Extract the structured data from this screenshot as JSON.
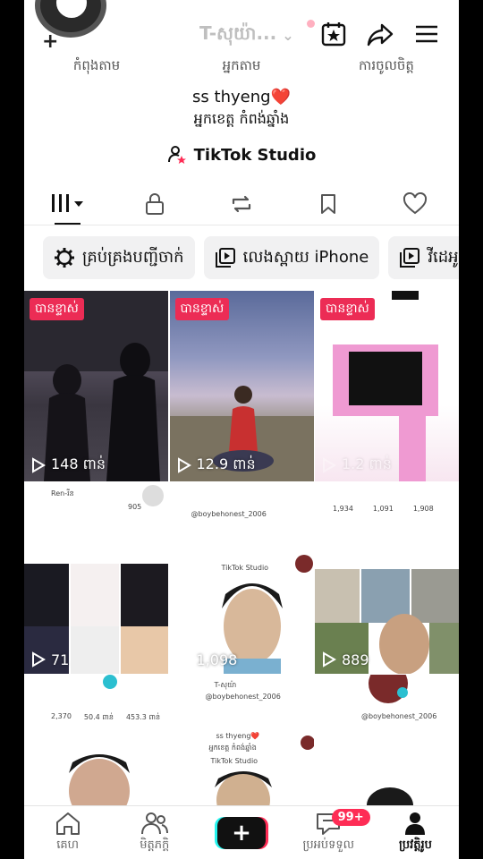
{
  "header": {
    "account_name": "T-សុយ៉ា...",
    "chevron": "⌄",
    "add_plus": "+"
  },
  "stats": [
    "កំពុងតាម",
    "អ្នកតាម",
    "ការចូលចិត្ត"
  ],
  "profile": {
    "name": "ss thyeng❤️",
    "bio": "អ្នកខេត្ត កំពង់ឆ្នាំង",
    "studio_label": "TikTok Studio"
  },
  "chips": [
    {
      "label": "គ្រប់គ្រងបញ្ជីចាក់",
      "icon": "gear-icon"
    },
    {
      "label": "លេងស្ពាយ iPhone",
      "icon": "play-square-icon"
    },
    {
      "label": "វីដេអូរអ",
      "icon": "play-square-icon"
    }
  ],
  "tiles": [
    {
      "badge": "បានខ្ទាស់",
      "views": "148 ពាន់"
    },
    {
      "badge": "បានខ្ទាស់",
      "views": "12.9 ពាន់"
    },
    {
      "badge": "បានខ្ទាស់",
      "views": "1.2 ពាន់"
    },
    {
      "views": "71"
    },
    {
      "views": "1,098"
    },
    {
      "views": "889"
    },
    {},
    {},
    {}
  ],
  "mini": {
    "tile4_user": "Ren-រីន",
    "tile4_stat": "905",
    "tile5_handle": "@boybehonest_2006",
    "tile5_studio": "TikTok Studio",
    "tile6_stats": [
      "1,934",
      "1,091",
      "1,908"
    ],
    "tile8_user": "T-សុយ៉ា",
    "tile8_handle": "@boybehonest_2006",
    "tile8_stats": [
      "2,370",
      "50.4 ពាន់",
      "453.3 ពាន់"
    ],
    "tile8_name": "ss thyeng❤️",
    "tile8_bio": "អ្នកខេត្ត កំពង់ឆ្នាំង",
    "tile8_studio": "TikTok Studio",
    "tile9_handle": "@boybehonest_2006"
  },
  "nav": {
    "home": "គេហ",
    "friends": "មិត្តភក្តិ",
    "inbox": "ប្រអប់ទទួល",
    "inbox_badge": "99+",
    "profile": "ប្រវត្តិរូប",
    "create": "+"
  }
}
